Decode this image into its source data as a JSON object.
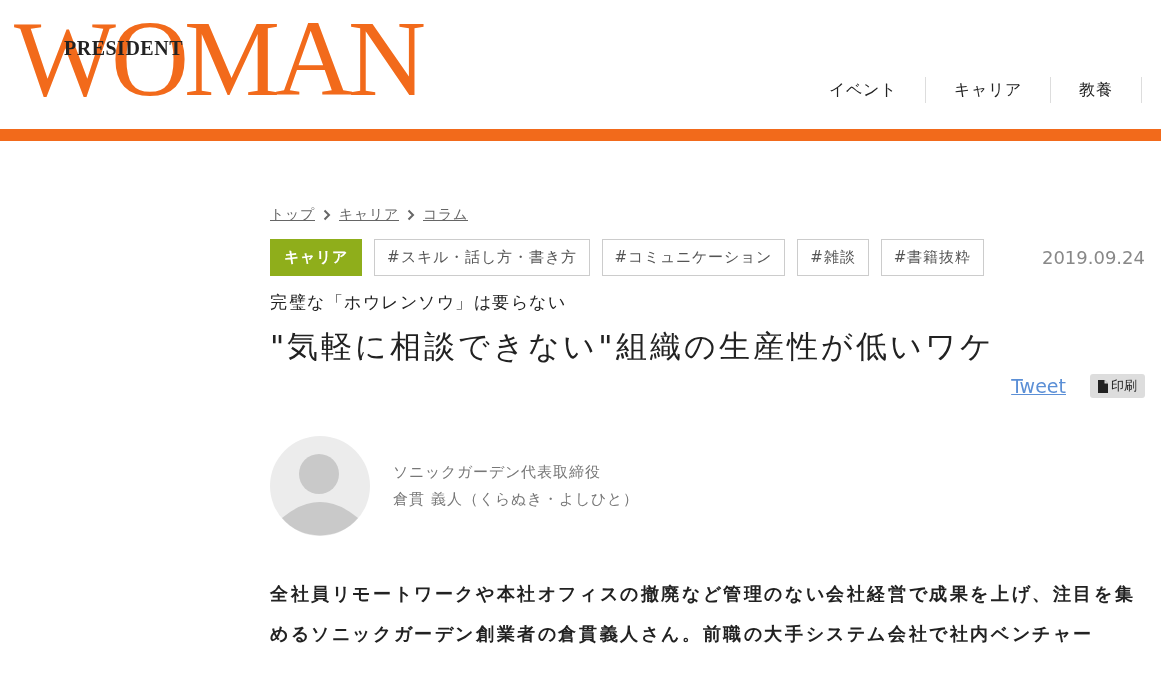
{
  "header": {
    "logo": {
      "main": "WOMAN",
      "overlay": "PRESIDENT"
    },
    "nav": [
      "イベント",
      "キャリア",
      "教養"
    ]
  },
  "breadcrumb": [
    "トップ",
    "キャリア",
    "コラム"
  ],
  "tags": [
    {
      "label": "キャリア",
      "kind": "category"
    },
    {
      "label": "#スキル・話し方・書き方",
      "kind": "hashtag"
    },
    {
      "label": "#コミュニケーション",
      "kind": "hashtag"
    },
    {
      "label": "#雑談",
      "kind": "hashtag"
    },
    {
      "label": "#書籍抜粋",
      "kind": "hashtag"
    }
  ],
  "date": "2019.09.24",
  "subtitle": "完璧な「ホウレンソウ」は要らない",
  "title": "\"気軽に相談できない\"組織の生産性が低いワケ",
  "share": {
    "tweet": "Tweet",
    "print": "印刷"
  },
  "author": {
    "role": "ソニックガーデン代表取締役",
    "name": "倉貫 義人（くらぬき・よしひと）"
  },
  "lead": "全社員リモートワークや本社オフィスの撤廃など管理のない会社経営で成果を上げ、注目を集めるソニックガーデン創業者の倉貫義人さん。前職の大手システム会社で社内ベンチャー"
}
